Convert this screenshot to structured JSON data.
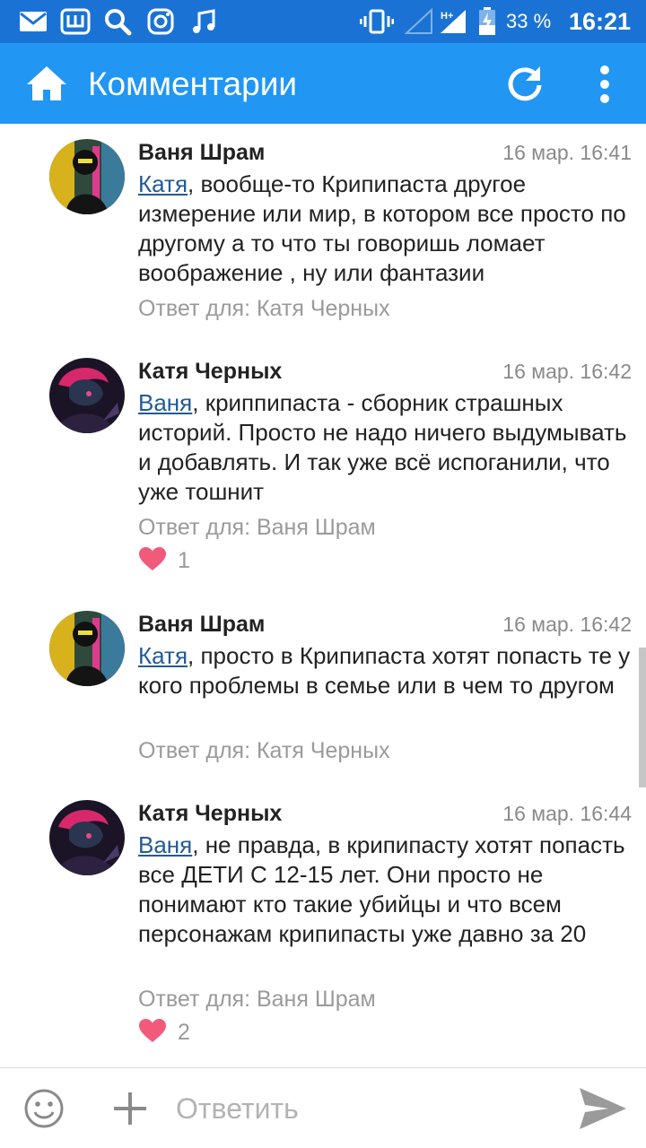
{
  "status_bar": {
    "battery": "33 %",
    "time": "16:21",
    "network": "H+"
  },
  "app_bar": {
    "title": "Комментарии"
  },
  "comments": [
    {
      "author": "Ваня Шрам",
      "time": "16 мар. 16:41",
      "mention": "Катя",
      "text": ", вообще-то Крипипаста другое измерение или мир, в котором все просто по другому а то что ты говоришь ломает воображение , ну или фантазии",
      "reply_to": "Ответ для: Катя Черных",
      "likes": null
    },
    {
      "author": "Катя Черных",
      "time": "16 мар. 16:42",
      "mention": "Ваня",
      "text": ", криппипаста - сборник страшных историй. Просто не надо ничего выдумывать и добавлять. И так уже всё испоганили, что уже тошнит",
      "reply_to": "Ответ для: Ваня Шрам",
      "likes": "1"
    },
    {
      "author": "Ваня Шрам",
      "time": "16 мар. 16:42",
      "mention": "Катя",
      "text": ", просто в Крипипаста хотят попасть те у кого проблемы в семье или в чем то другом",
      "reply_to": "Ответ для: Катя Черных",
      "likes": null
    },
    {
      "author": "Катя Черных",
      "time": "16 мар. 16:44",
      "mention": "Ваня",
      "text": ", не правда, в крипипасту хотят попасть все ДЕТИ С 12-15 лет. Они просто не понимают кто такие убийцы и что всем персонажам крипипасты уже давно за 20",
      "reply_to": "Ответ для: Ваня Шрам",
      "likes": "2"
    }
  ],
  "composer": {
    "placeholder": "Ответить"
  },
  "colors": {
    "status_bar": "#1a73d4",
    "app_bar": "#2196f3",
    "mention": "#235a95",
    "heart": "#f25a7c"
  },
  "icons": {
    "home": "home-icon",
    "refresh": "refresh-icon",
    "menu": "more-vert-icon",
    "heart": "heart-icon",
    "emoji": "emoji-icon",
    "plus": "plus-icon",
    "send": "send-icon"
  }
}
